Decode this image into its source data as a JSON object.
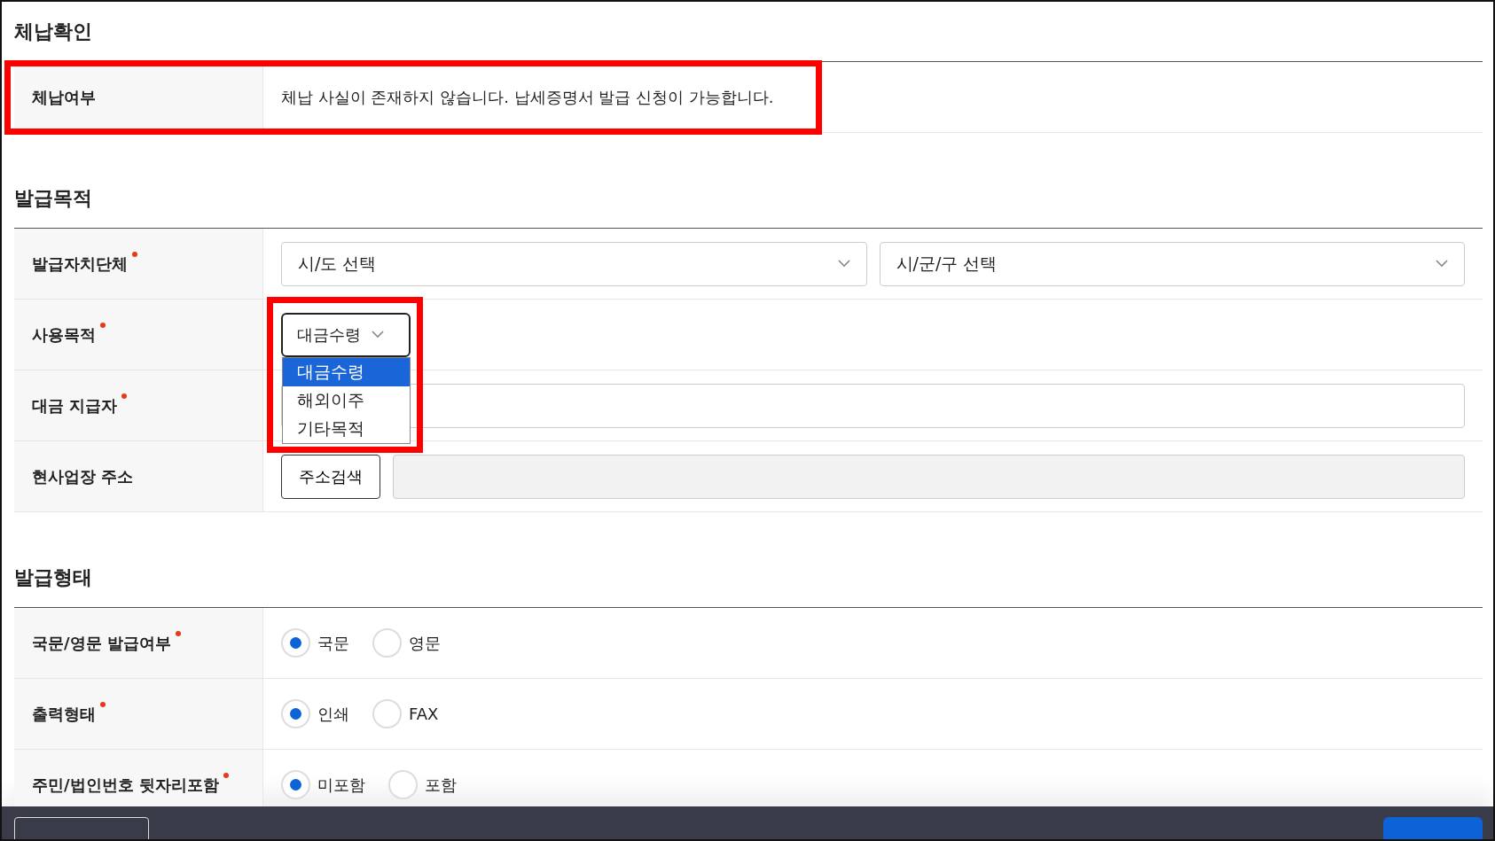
{
  "sections": [
    {
      "title": "체납확인",
      "rows": [
        {
          "label": "체납여부",
          "required": false,
          "highlighted": true,
          "kind": "text",
          "text": "체납 사실이 존재하지 않습니다. 납세증명서 발급 신청이 가능합니다."
        }
      ]
    },
    {
      "title": "발급목적",
      "rows": [
        {
          "label": "발급자치단체",
          "required": true,
          "kind": "selects",
          "selects": [
            {
              "value": "시/도 선택"
            },
            {
              "value": "시/군/구 선택"
            }
          ]
        },
        {
          "label": "사용목적",
          "required": true,
          "kind": "dropdown",
          "highlighted": true,
          "value": "대금수령",
          "expanded": true,
          "options": [
            {
              "label": "대금수령",
              "selected": true
            },
            {
              "label": "해외이주",
              "selected": false
            },
            {
              "label": "기타목적",
              "selected": false
            }
          ]
        },
        {
          "label": "대금 지급자",
          "required": true,
          "kind": "input"
        },
        {
          "label": "현사업장 주소",
          "required": false,
          "kind": "address",
          "button": "주소검색"
        }
      ]
    },
    {
      "title": "발급형태",
      "rows": [
        {
          "label": "국문/영문 발급여부",
          "required": true,
          "kind": "radios",
          "options": [
            {
              "label": "국문",
              "selected": true
            },
            {
              "label": "영문",
              "selected": false
            }
          ]
        },
        {
          "label": "출력형태",
          "required": true,
          "kind": "radios",
          "options": [
            {
              "label": "인쇄",
              "selected": true
            },
            {
              "label": "FAX",
              "selected": false
            }
          ]
        },
        {
          "label": "주민/법인번호 뒷자리포함",
          "required": true,
          "kind": "radios",
          "options": [
            {
              "label": "미포함",
              "selected": true
            },
            {
              "label": "포함",
              "selected": false
            }
          ]
        }
      ]
    }
  ]
}
